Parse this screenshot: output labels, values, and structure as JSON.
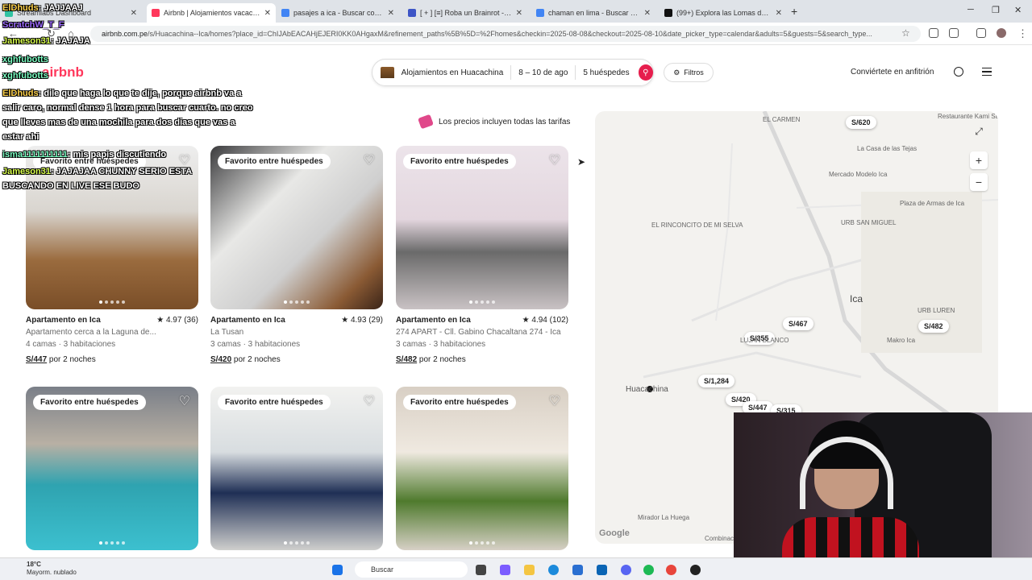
{
  "browser": {
    "tabs": [
      {
        "label": "Streamlabs Dashboard",
        "icon": "streamlabs-icon",
        "color": "#31c3a2"
      },
      {
        "label": "Airbnb | Alojamientos vacacion",
        "icon": "airbnb-icon",
        "color": "#ff385c"
      },
      {
        "label": "pasajes a ica - Buscar con Goo",
        "icon": "google-icon",
        "color": "#4285f4"
      },
      {
        "label": "[ + ] [≡] Roba un Brainrot - Ro",
        "icon": "roblox-icon",
        "color": "#3d55c6"
      },
      {
        "label": "chaman en lima - Buscar con G",
        "icon": "google-icon",
        "color": "#4285f4"
      },
      {
        "label": "(99+) Explora las Lomas de Luc",
        "icon": "tiktok-icon",
        "color": "#111111"
      }
    ],
    "url_host": "airbnb.com.pe",
    "url_path": "/s/Huacachina--Ica/homes?place_id=ChIJAbEACAHjEJERI0KK0AHgaxM&refinement_paths%5B%5D=%2Fhomes&checkin=2025-08-08&checkout=2025-08-10&date_picker_type=calendar&adults=5&guests=5&search_type..."
  },
  "header": {
    "logo": "airbnb",
    "search": {
      "location": "Alojamientos en Huacachina",
      "dates": "8 – 10 de ago",
      "guests": "5 huéspedes"
    },
    "filters_label": "Filtros",
    "host_link": "Conviértete en anfitrión"
  },
  "price_note": "Los precios incluyen todas las tarifas",
  "listings": [
    {
      "badge": "Favorito entre huéspedes",
      "title": "Apartamento en Ica",
      "rating": "★ 4.97 (36)",
      "desc": "Apartamento cerca a la Laguna de...",
      "beds": "4 camas · 3 habitaciones",
      "price": "S/447",
      "price_suffix": "por 2 noches",
      "bg": "linear-gradient(180deg,#eeeeee 0%,#d9d5cf 40%,#9a6b3e 70%,#7a4e28 100%)"
    },
    {
      "badge": "Favorito entre huéspedes",
      "title": "Apartamento en Ica",
      "rating": "★ 4.93 (29)",
      "desc": "La Tusan",
      "beds": "3 camas · 3 habitaciones",
      "price": "S/420",
      "price_suffix": "por 2 noches",
      "bg": "linear-gradient(135deg,#3a3a3c 0%,#e8e8e6 35%,#cfcfcf 60%,#8a5a34 85%,#3a2418 100%)"
    },
    {
      "badge": "Favorito entre huéspedes",
      "title": "Apartamento en Ica",
      "rating": "★ 4.94 (102)",
      "desc": "274 APART - Cll. Gabino Chacaltana 274 - Ica",
      "beds": "3 camas · 3 habitaciones",
      "price": "S/482",
      "price_suffix": "por 2 noches",
      "bg": "linear-gradient(180deg,#ece4ea 0%,#e3d6de 45%,#6a6a6a 65%,#c9c2c4 100%)"
    },
    {
      "badge": "Favorito entre huéspedes",
      "title": "",
      "rating": "",
      "desc": "",
      "beds": "",
      "price": "",
      "price_suffix": "",
      "bg": "linear-gradient(180deg,#7a7f88 0%,#b8b0a4 35%,#2fa3b0 60%,#3cc0cf 100%)"
    },
    {
      "badge": "Favorito entre huéspedes",
      "title": "",
      "rating": "",
      "desc": "",
      "beds": "",
      "price": "",
      "price_suffix": "",
      "bg": "linear-gradient(180deg,#f2f2f0 0%,#d8dde0 40%,#1f2f55 65%,#cfcfcd 100%)"
    },
    {
      "badge": "Favorito entre huéspedes",
      "title": "",
      "rating": "",
      "desc": "",
      "beds": "",
      "price": "",
      "price_suffix": "",
      "bg": "linear-gradient(180deg,#d8cfc4 0%,#efe9e0 40%,#4f7a2d 70%,#d7d0c6 100%)"
    }
  ],
  "map": {
    "price_pins": [
      "S/620",
      "S/467",
      "S/482",
      "S/355",
      "S/1,284",
      "S/420",
      "S/447",
      "S/315"
    ],
    "labels": [
      "Restaurante Kami Sabor A...",
      "EL CARMEN",
      "La Casa de las Tejas",
      "Mercado Modelo Ica",
      "Plaza de Armas de Ica",
      "URB SAN MIGUEL",
      "EL RINCONCITO DE MI SELVA",
      "Ica",
      "URB LUREN",
      "Makro Ica",
      "LUJAN BLANCO",
      "Huacachina",
      "Mirador La Huega",
      "Google",
      "Combinacio"
    ],
    "zoom_in": "+",
    "zoom_out": "−"
  },
  "chat": [
    {
      "user": "ElDhuds",
      "msg": ": JAJJAAJ"
    },
    {
      "user": "ScratchW_T_F",
      "msg": ""
    },
    {
      "user": "Jameson31",
      "msg": ": JAJAJA"
    },
    {
      "user": "xghfubotts",
      "msg": ""
    },
    {
      "user": "xghfubotts",
      "msg": ""
    },
    {
      "user": "ElDhuds",
      "msg": ": dile que haga lo que te dije, porque airbnb va a"
    },
    {
      "user": "",
      "msg": "salir caro, normal dense 1 hora para buscar cuarto. no creo"
    },
    {
      "user": "",
      "msg": "que lleves mas de una mochila para dos dias que vas a"
    },
    {
      "user": "",
      "msg": "estar ahi"
    },
    {
      "user": "isma1111111111",
      "msg": ": mis papis discutiendo"
    },
    {
      "user": "Jameson31",
      "msg": ": JAJAJAA CHUNNY SERIO ESTA"
    },
    {
      "user": "",
      "msg": "BUSCANDO EN LIVE ESE BUDO"
    }
  ],
  "taskbar": {
    "weather_temp": "18°C",
    "weather_desc": "Mayorm. nublado",
    "search_label": "Buscar"
  }
}
